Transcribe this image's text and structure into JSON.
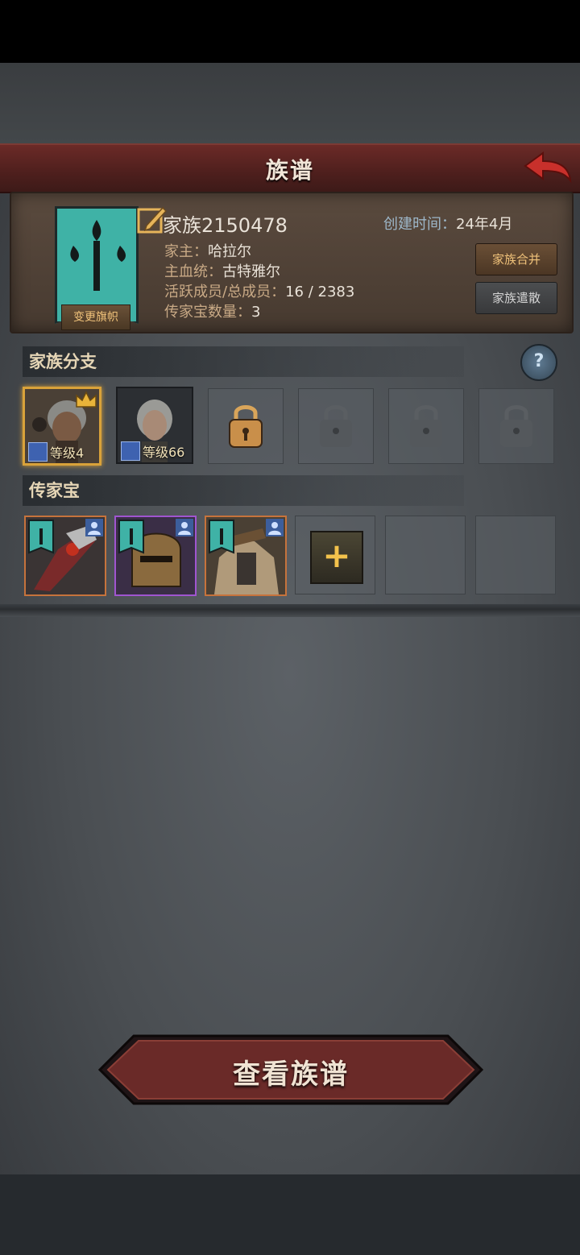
{
  "title": "族谱",
  "header": {
    "banner_change_label": "变更旗帜",
    "family_name": "家族2150478",
    "create_time_label": "创建时间：",
    "create_time_value": "24年4月",
    "head_label": "家主：",
    "head_value": "哈拉尔",
    "bloodline_label": "主血统：",
    "bloodline_value": "古特雅尔",
    "members_label": "活跃成员/总成员：",
    "members_value": "16 / 2383",
    "heirloom_count_label": "传家宝数量：",
    "heirloom_count_value": "3",
    "merge_button": "家族合并",
    "disband_button": "家族遣散",
    "banner_color": "#3fb2a6"
  },
  "branches": {
    "section_title": "家族分支",
    "help_label": "?",
    "members": [
      {
        "level_label": "等级4",
        "crowned": true
      },
      {
        "level_label": "等级66",
        "crowned": false
      }
    ]
  },
  "heirlooms": {
    "section_title": "传家宝",
    "add_label": "+"
  },
  "view_button": "查看族谱"
}
